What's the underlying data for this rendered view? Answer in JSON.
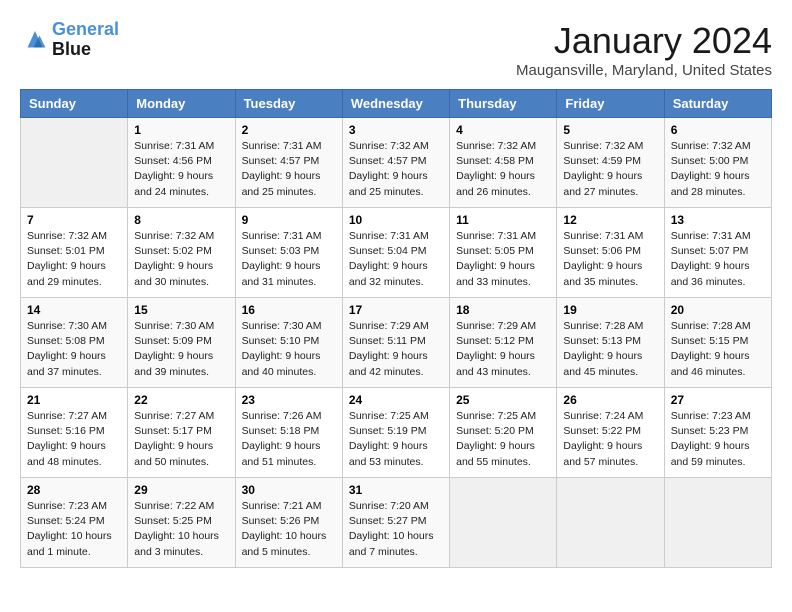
{
  "header": {
    "logo_line1": "General",
    "logo_line2": "Blue",
    "month": "January 2024",
    "location": "Maugansville, Maryland, United States"
  },
  "days_of_week": [
    "Sunday",
    "Monday",
    "Tuesday",
    "Wednesday",
    "Thursday",
    "Friday",
    "Saturday"
  ],
  "weeks": [
    [
      {
        "num": "",
        "sunrise": "",
        "sunset": "",
        "daylight": ""
      },
      {
        "num": "1",
        "sunrise": "Sunrise: 7:31 AM",
        "sunset": "Sunset: 4:56 PM",
        "daylight": "Daylight: 9 hours and 24 minutes."
      },
      {
        "num": "2",
        "sunrise": "Sunrise: 7:31 AM",
        "sunset": "Sunset: 4:57 PM",
        "daylight": "Daylight: 9 hours and 25 minutes."
      },
      {
        "num": "3",
        "sunrise": "Sunrise: 7:32 AM",
        "sunset": "Sunset: 4:57 PM",
        "daylight": "Daylight: 9 hours and 25 minutes."
      },
      {
        "num": "4",
        "sunrise": "Sunrise: 7:32 AM",
        "sunset": "Sunset: 4:58 PM",
        "daylight": "Daylight: 9 hours and 26 minutes."
      },
      {
        "num": "5",
        "sunrise": "Sunrise: 7:32 AM",
        "sunset": "Sunset: 4:59 PM",
        "daylight": "Daylight: 9 hours and 27 minutes."
      },
      {
        "num": "6",
        "sunrise": "Sunrise: 7:32 AM",
        "sunset": "Sunset: 5:00 PM",
        "daylight": "Daylight: 9 hours and 28 minutes."
      }
    ],
    [
      {
        "num": "7",
        "sunrise": "Sunrise: 7:32 AM",
        "sunset": "Sunset: 5:01 PM",
        "daylight": "Daylight: 9 hours and 29 minutes."
      },
      {
        "num": "8",
        "sunrise": "Sunrise: 7:32 AM",
        "sunset": "Sunset: 5:02 PM",
        "daylight": "Daylight: 9 hours and 30 minutes."
      },
      {
        "num": "9",
        "sunrise": "Sunrise: 7:31 AM",
        "sunset": "Sunset: 5:03 PM",
        "daylight": "Daylight: 9 hours and 31 minutes."
      },
      {
        "num": "10",
        "sunrise": "Sunrise: 7:31 AM",
        "sunset": "Sunset: 5:04 PM",
        "daylight": "Daylight: 9 hours and 32 minutes."
      },
      {
        "num": "11",
        "sunrise": "Sunrise: 7:31 AM",
        "sunset": "Sunset: 5:05 PM",
        "daylight": "Daylight: 9 hours and 33 minutes."
      },
      {
        "num": "12",
        "sunrise": "Sunrise: 7:31 AM",
        "sunset": "Sunset: 5:06 PM",
        "daylight": "Daylight: 9 hours and 35 minutes."
      },
      {
        "num": "13",
        "sunrise": "Sunrise: 7:31 AM",
        "sunset": "Sunset: 5:07 PM",
        "daylight": "Daylight: 9 hours and 36 minutes."
      }
    ],
    [
      {
        "num": "14",
        "sunrise": "Sunrise: 7:30 AM",
        "sunset": "Sunset: 5:08 PM",
        "daylight": "Daylight: 9 hours and 37 minutes."
      },
      {
        "num": "15",
        "sunrise": "Sunrise: 7:30 AM",
        "sunset": "Sunset: 5:09 PM",
        "daylight": "Daylight: 9 hours and 39 minutes."
      },
      {
        "num": "16",
        "sunrise": "Sunrise: 7:30 AM",
        "sunset": "Sunset: 5:10 PM",
        "daylight": "Daylight: 9 hours and 40 minutes."
      },
      {
        "num": "17",
        "sunrise": "Sunrise: 7:29 AM",
        "sunset": "Sunset: 5:11 PM",
        "daylight": "Daylight: 9 hours and 42 minutes."
      },
      {
        "num": "18",
        "sunrise": "Sunrise: 7:29 AM",
        "sunset": "Sunset: 5:12 PM",
        "daylight": "Daylight: 9 hours and 43 minutes."
      },
      {
        "num": "19",
        "sunrise": "Sunrise: 7:28 AM",
        "sunset": "Sunset: 5:13 PM",
        "daylight": "Daylight: 9 hours and 45 minutes."
      },
      {
        "num": "20",
        "sunrise": "Sunrise: 7:28 AM",
        "sunset": "Sunset: 5:15 PM",
        "daylight": "Daylight: 9 hours and 46 minutes."
      }
    ],
    [
      {
        "num": "21",
        "sunrise": "Sunrise: 7:27 AM",
        "sunset": "Sunset: 5:16 PM",
        "daylight": "Daylight: 9 hours and 48 minutes."
      },
      {
        "num": "22",
        "sunrise": "Sunrise: 7:27 AM",
        "sunset": "Sunset: 5:17 PM",
        "daylight": "Daylight: 9 hours and 50 minutes."
      },
      {
        "num": "23",
        "sunrise": "Sunrise: 7:26 AM",
        "sunset": "Sunset: 5:18 PM",
        "daylight": "Daylight: 9 hours and 51 minutes."
      },
      {
        "num": "24",
        "sunrise": "Sunrise: 7:25 AM",
        "sunset": "Sunset: 5:19 PM",
        "daylight": "Daylight: 9 hours and 53 minutes."
      },
      {
        "num": "25",
        "sunrise": "Sunrise: 7:25 AM",
        "sunset": "Sunset: 5:20 PM",
        "daylight": "Daylight: 9 hours and 55 minutes."
      },
      {
        "num": "26",
        "sunrise": "Sunrise: 7:24 AM",
        "sunset": "Sunset: 5:22 PM",
        "daylight": "Daylight: 9 hours and 57 minutes."
      },
      {
        "num": "27",
        "sunrise": "Sunrise: 7:23 AM",
        "sunset": "Sunset: 5:23 PM",
        "daylight": "Daylight: 9 hours and 59 minutes."
      }
    ],
    [
      {
        "num": "28",
        "sunrise": "Sunrise: 7:23 AM",
        "sunset": "Sunset: 5:24 PM",
        "daylight": "Daylight: 10 hours and 1 minute."
      },
      {
        "num": "29",
        "sunrise": "Sunrise: 7:22 AM",
        "sunset": "Sunset: 5:25 PM",
        "daylight": "Daylight: 10 hours and 3 minutes."
      },
      {
        "num": "30",
        "sunrise": "Sunrise: 7:21 AM",
        "sunset": "Sunset: 5:26 PM",
        "daylight": "Daylight: 10 hours and 5 minutes."
      },
      {
        "num": "31",
        "sunrise": "Sunrise: 7:20 AM",
        "sunset": "Sunset: 5:27 PM",
        "daylight": "Daylight: 10 hours and 7 minutes."
      },
      {
        "num": "",
        "sunrise": "",
        "sunset": "",
        "daylight": ""
      },
      {
        "num": "",
        "sunrise": "",
        "sunset": "",
        "daylight": ""
      },
      {
        "num": "",
        "sunrise": "",
        "sunset": "",
        "daylight": ""
      }
    ]
  ]
}
